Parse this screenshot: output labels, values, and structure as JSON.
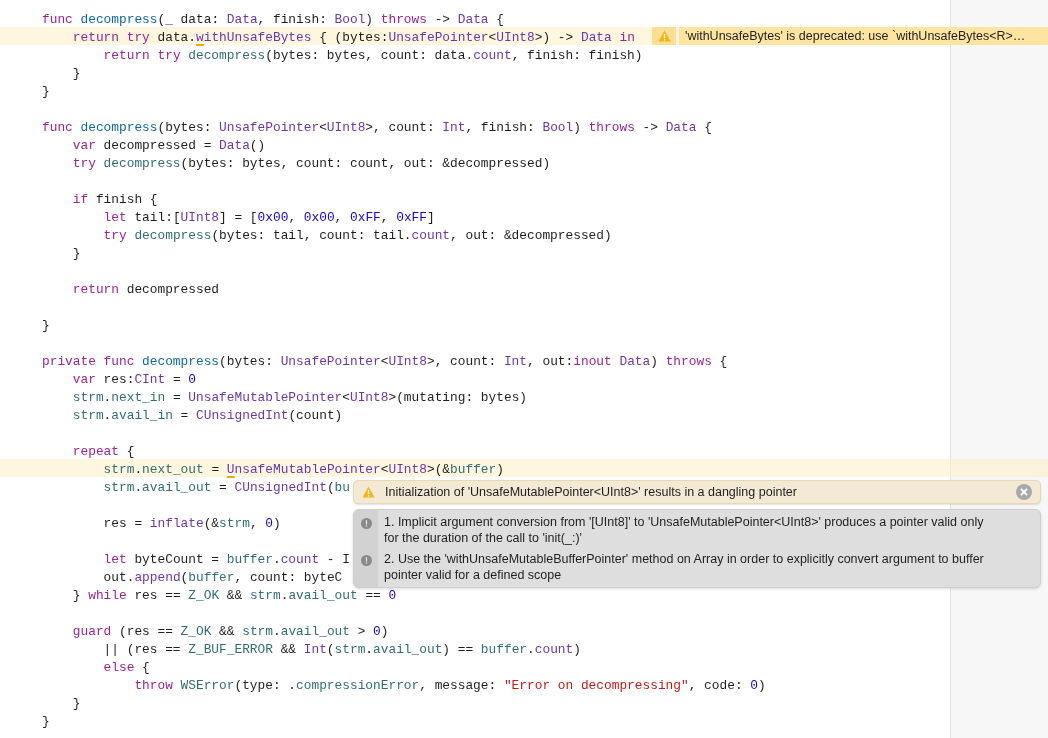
{
  "editor": {
    "lines": [
      {
        "kind": "code",
        "highlighted": false,
        "tokens": [
          {
            "t": "func ",
            "kind": "keyword"
          },
          {
            "t": "decompress",
            "kind": "decl"
          },
          {
            "t": "("
          },
          {
            "t": "_",
            "kind": "keyword"
          },
          {
            "t": " data: "
          },
          {
            "t": "Data",
            "kind": "type"
          },
          {
            "t": ", finish: "
          },
          {
            "t": "Bool",
            "kind": "type"
          },
          {
            "t": ") "
          },
          {
            "t": "throws",
            "kind": "keyword"
          },
          {
            "t": " -> "
          },
          {
            "t": "Data",
            "kind": "type"
          },
          {
            "t": " {"
          }
        ]
      },
      {
        "kind": "code",
        "highlighted": true,
        "tokens": [
          {
            "t": "    return",
            "kind": "keyword"
          },
          {
            "t": " try",
            "kind": "keyword"
          },
          {
            "t": " data."
          },
          {
            "t": "w",
            "kind": "flagged"
          },
          {
            "t": "ithUnsafeBytes",
            "kind": "system"
          },
          {
            "t": " { (bytes:"
          },
          {
            "t": "UnsafePointer",
            "kind": "type"
          },
          {
            "t": "<"
          },
          {
            "t": "UInt8",
            "kind": "type"
          },
          {
            "t": ">) -> "
          },
          {
            "t": "Data",
            "kind": "type"
          },
          {
            "t": " in",
            "kind": "keyword"
          }
        ]
      },
      {
        "kind": "code",
        "highlighted": false,
        "tokens": [
          {
            "t": "        return",
            "kind": "keyword"
          },
          {
            "t": " try",
            "kind": "keyword"
          },
          {
            "t": " decompress",
            "kind": "project"
          },
          {
            "t": "(bytes: bytes, count: data."
          },
          {
            "t": "count",
            "kind": "system"
          },
          {
            "t": ", finish: finish)"
          }
        ]
      },
      {
        "kind": "code",
        "highlighted": false,
        "tokens": [
          {
            "t": "    }"
          }
        ]
      },
      {
        "kind": "code",
        "highlighted": false,
        "tokens": [
          {
            "t": "}"
          }
        ]
      },
      {
        "kind": "blank"
      },
      {
        "kind": "code",
        "highlighted": false,
        "tokens": [
          {
            "t": "func ",
            "kind": "keyword"
          },
          {
            "t": "decompress",
            "kind": "decl"
          },
          {
            "t": "(bytes: "
          },
          {
            "t": "UnsafePointer",
            "kind": "type"
          },
          {
            "t": "<"
          },
          {
            "t": "UInt8",
            "kind": "type"
          },
          {
            "t": ">, count: "
          },
          {
            "t": "Int",
            "kind": "type"
          },
          {
            "t": ", finish: "
          },
          {
            "t": "Bool",
            "kind": "type"
          },
          {
            "t": ") "
          },
          {
            "t": "throws",
            "kind": "keyword"
          },
          {
            "t": " -> "
          },
          {
            "t": "Data",
            "kind": "type"
          },
          {
            "t": " {"
          }
        ]
      },
      {
        "kind": "code",
        "highlighted": false,
        "tokens": [
          {
            "t": "    var",
            "kind": "keyword"
          },
          {
            "t": " decompressed = "
          },
          {
            "t": "Data",
            "kind": "type"
          },
          {
            "t": "()"
          }
        ]
      },
      {
        "kind": "code",
        "highlighted": false,
        "tokens": [
          {
            "t": "    try",
            "kind": "keyword"
          },
          {
            "t": " decompress",
            "kind": "project"
          },
          {
            "t": "(bytes: bytes, count: count, out: &decompressed)"
          }
        ]
      },
      {
        "kind": "blank"
      },
      {
        "kind": "code",
        "highlighted": false,
        "tokens": [
          {
            "t": "    if",
            "kind": "keyword"
          },
          {
            "t": " finish {"
          }
        ]
      },
      {
        "kind": "code",
        "highlighted": false,
        "tokens": [
          {
            "t": "        let",
            "kind": "keyword"
          },
          {
            "t": " tail:["
          },
          {
            "t": "UInt8",
            "kind": "type"
          },
          {
            "t": "] = ["
          },
          {
            "t": "0x00",
            "kind": "number"
          },
          {
            "t": ", "
          },
          {
            "t": "0x00",
            "kind": "number"
          },
          {
            "t": ", "
          },
          {
            "t": "0xFF",
            "kind": "number"
          },
          {
            "t": ", "
          },
          {
            "t": "0xFF",
            "kind": "number"
          },
          {
            "t": "]"
          }
        ]
      },
      {
        "kind": "code",
        "highlighted": false,
        "tokens": [
          {
            "t": "        try",
            "kind": "keyword"
          },
          {
            "t": " decompress",
            "kind": "project"
          },
          {
            "t": "(bytes: tail, count: tail."
          },
          {
            "t": "count",
            "kind": "system"
          },
          {
            "t": ", out: &decompressed)"
          }
        ]
      },
      {
        "kind": "code",
        "highlighted": false,
        "tokens": [
          {
            "t": "    }"
          }
        ]
      },
      {
        "kind": "blank"
      },
      {
        "kind": "code",
        "highlighted": false,
        "tokens": [
          {
            "t": "    return",
            "kind": "keyword"
          },
          {
            "t": " decompressed"
          }
        ]
      },
      {
        "kind": "blank"
      },
      {
        "kind": "code",
        "highlighted": false,
        "tokens": [
          {
            "t": "}"
          }
        ]
      },
      {
        "kind": "blank"
      },
      {
        "kind": "code",
        "highlighted": false,
        "tokens": [
          {
            "t": "private func ",
            "kind": "keyword"
          },
          {
            "t": "decompress",
            "kind": "decl"
          },
          {
            "t": "(bytes: "
          },
          {
            "t": "UnsafePointer",
            "kind": "type"
          },
          {
            "t": "<"
          },
          {
            "t": "UInt8",
            "kind": "type"
          },
          {
            "t": ">, count: "
          },
          {
            "t": "Int",
            "kind": "type"
          },
          {
            "t": ", out:"
          },
          {
            "t": "inout ",
            "kind": "keyword"
          },
          {
            "t": "Data",
            "kind": "type"
          },
          {
            "t": ") "
          },
          {
            "t": "throws",
            "kind": "keyword"
          },
          {
            "t": " {"
          }
        ]
      },
      {
        "kind": "code",
        "highlighted": false,
        "tokens": [
          {
            "t": "    var",
            "kind": "keyword"
          },
          {
            "t": " res:"
          },
          {
            "t": "CInt",
            "kind": "type"
          },
          {
            "t": " = "
          },
          {
            "t": "0",
            "kind": "number"
          }
        ]
      },
      {
        "kind": "code",
        "highlighted": false,
        "tokens": [
          {
            "t": "    strm",
            "kind": "project"
          },
          {
            "t": "."
          },
          {
            "t": "next_in",
            "kind": "project"
          },
          {
            "t": " = "
          },
          {
            "t": "UnsafeMutablePointer",
            "kind": "type"
          },
          {
            "t": "<"
          },
          {
            "t": "UInt8",
            "kind": "type"
          },
          {
            "t": ">(mutating: bytes)"
          }
        ]
      },
      {
        "kind": "code",
        "highlighted": false,
        "tokens": [
          {
            "t": "    strm",
            "kind": "project"
          },
          {
            "t": "."
          },
          {
            "t": "avail_in",
            "kind": "project"
          },
          {
            "t": " = "
          },
          {
            "t": "CUnsignedInt",
            "kind": "type"
          },
          {
            "t": "(count)"
          }
        ]
      },
      {
        "kind": "blank"
      },
      {
        "kind": "code",
        "highlighted": false,
        "tokens": [
          {
            "t": "    repeat",
            "kind": "keyword"
          },
          {
            "t": " {"
          }
        ]
      },
      {
        "kind": "code",
        "highlighted": true,
        "tokens": [
          {
            "t": "        strm",
            "kind": "project"
          },
          {
            "t": "."
          },
          {
            "t": "next_out",
            "kind": "project"
          },
          {
            "t": " = "
          },
          {
            "t": "U",
            "kind": "flagged"
          },
          {
            "t": "nsafeMutablePointer",
            "kind": "type"
          },
          {
            "t": "<"
          },
          {
            "t": "UInt8",
            "kind": "type"
          },
          {
            "t": ">(&"
          },
          {
            "t": "buffer",
            "kind": "project"
          },
          {
            "t": ")"
          }
        ]
      },
      {
        "kind": "code",
        "highlighted": false,
        "tokens": [
          {
            "t": "        strm",
            "kind": "project"
          },
          {
            "t": "."
          },
          {
            "t": "avail_out",
            "kind": "project"
          },
          {
            "t": " = "
          },
          {
            "t": "CUnsignedInt",
            "kind": "type"
          },
          {
            "t": "("
          },
          {
            "t": "bu",
            "kind": "project"
          }
        ]
      },
      {
        "kind": "blank"
      },
      {
        "kind": "code",
        "highlighted": false,
        "tokens": [
          {
            "t": "        res = "
          },
          {
            "t": "inflate",
            "kind": "system"
          },
          {
            "t": "(&"
          },
          {
            "t": "strm",
            "kind": "project"
          },
          {
            "t": ", "
          },
          {
            "t": "0",
            "kind": "number"
          },
          {
            "t": ")"
          }
        ]
      },
      {
        "kind": "blank"
      },
      {
        "kind": "code",
        "highlighted": false,
        "tokens": [
          {
            "t": "        let",
            "kind": "keyword"
          },
          {
            "t": " byteCount = "
          },
          {
            "t": "buffer",
            "kind": "project"
          },
          {
            "t": "."
          },
          {
            "t": "count",
            "kind": "system"
          },
          {
            "t": " - I"
          }
        ]
      },
      {
        "kind": "code",
        "highlighted": false,
        "tokens": [
          {
            "t": "        out."
          },
          {
            "t": "append",
            "kind": "system"
          },
          {
            "t": "("
          },
          {
            "t": "buffer",
            "kind": "project"
          },
          {
            "t": ", count: byteC"
          }
        ]
      },
      {
        "kind": "code",
        "highlighted": false,
        "tokens": [
          {
            "t": "    } "
          },
          {
            "t": "while",
            "kind": "keyword"
          },
          {
            "t": " res == "
          },
          {
            "t": "Z_OK",
            "kind": "project"
          },
          {
            "t": " && "
          },
          {
            "t": "strm",
            "kind": "project"
          },
          {
            "t": "."
          },
          {
            "t": "avail_out",
            "kind": "project"
          },
          {
            "t": " == "
          },
          {
            "t": "0",
            "kind": "number"
          }
        ]
      },
      {
        "kind": "blank"
      },
      {
        "kind": "code",
        "highlighted": false,
        "tokens": [
          {
            "t": "    guard",
            "kind": "keyword"
          },
          {
            "t": " (res == "
          },
          {
            "t": "Z_OK",
            "kind": "project"
          },
          {
            "t": " && "
          },
          {
            "t": "strm",
            "kind": "project"
          },
          {
            "t": "."
          },
          {
            "t": "avail_out",
            "kind": "project"
          },
          {
            "t": " > "
          },
          {
            "t": "0",
            "kind": "number"
          },
          {
            "t": ")"
          }
        ]
      },
      {
        "kind": "code",
        "highlighted": false,
        "tokens": [
          {
            "t": "        || (res == "
          },
          {
            "t": "Z_BUF_ERROR",
            "kind": "project"
          },
          {
            "t": " && "
          },
          {
            "t": "Int",
            "kind": "type"
          },
          {
            "t": "("
          },
          {
            "t": "strm",
            "kind": "project"
          },
          {
            "t": "."
          },
          {
            "t": "avail_out",
            "kind": "project"
          },
          {
            "t": ") == "
          },
          {
            "t": "buffer",
            "kind": "project"
          },
          {
            "t": "."
          },
          {
            "t": "count",
            "kind": "system"
          },
          {
            "t": ")"
          }
        ]
      },
      {
        "kind": "code",
        "highlighted": false,
        "tokens": [
          {
            "t": "        else",
            "kind": "keyword"
          },
          {
            "t": " {"
          }
        ]
      },
      {
        "kind": "code",
        "highlighted": false,
        "tokens": [
          {
            "t": "            throw",
            "kind": "keyword"
          },
          {
            "t": " WSError",
            "kind": "project"
          },
          {
            "t": "(type: ."
          },
          {
            "t": "compressionError",
            "kind": "project"
          },
          {
            "t": ", message: "
          },
          {
            "t": "\"Error on decompressing\"",
            "kind": "string"
          },
          {
            "t": ", code: "
          },
          {
            "t": "0",
            "kind": "number"
          },
          {
            "t": ")"
          }
        ]
      },
      {
        "kind": "code",
        "highlighted": false,
        "tokens": [
          {
            "t": "    }"
          }
        ]
      },
      {
        "kind": "code",
        "highlighted": false,
        "tokens": [
          {
            "t": "}"
          }
        ]
      }
    ]
  },
  "inline_warning": {
    "message": "'withUnsafeBytes' is deprecated: use `withUnsafeBytes<R>…"
  },
  "issue_popup": {
    "message": "Initialization of 'UnsafeMutablePointer<UInt8>' results in a dangling pointer",
    "notes": [
      "1. Implicit argument conversion from '[UInt8]' to 'UnsafeMutablePointer<UInt8>' produces a pointer valid only for the duration of the call to 'init(_:)'",
      "2. Use the 'withUnsafeMutableBufferPointer' method on Array in order to explicitly convert argument to buffer pointer valid for a defined scope"
    ]
  }
}
